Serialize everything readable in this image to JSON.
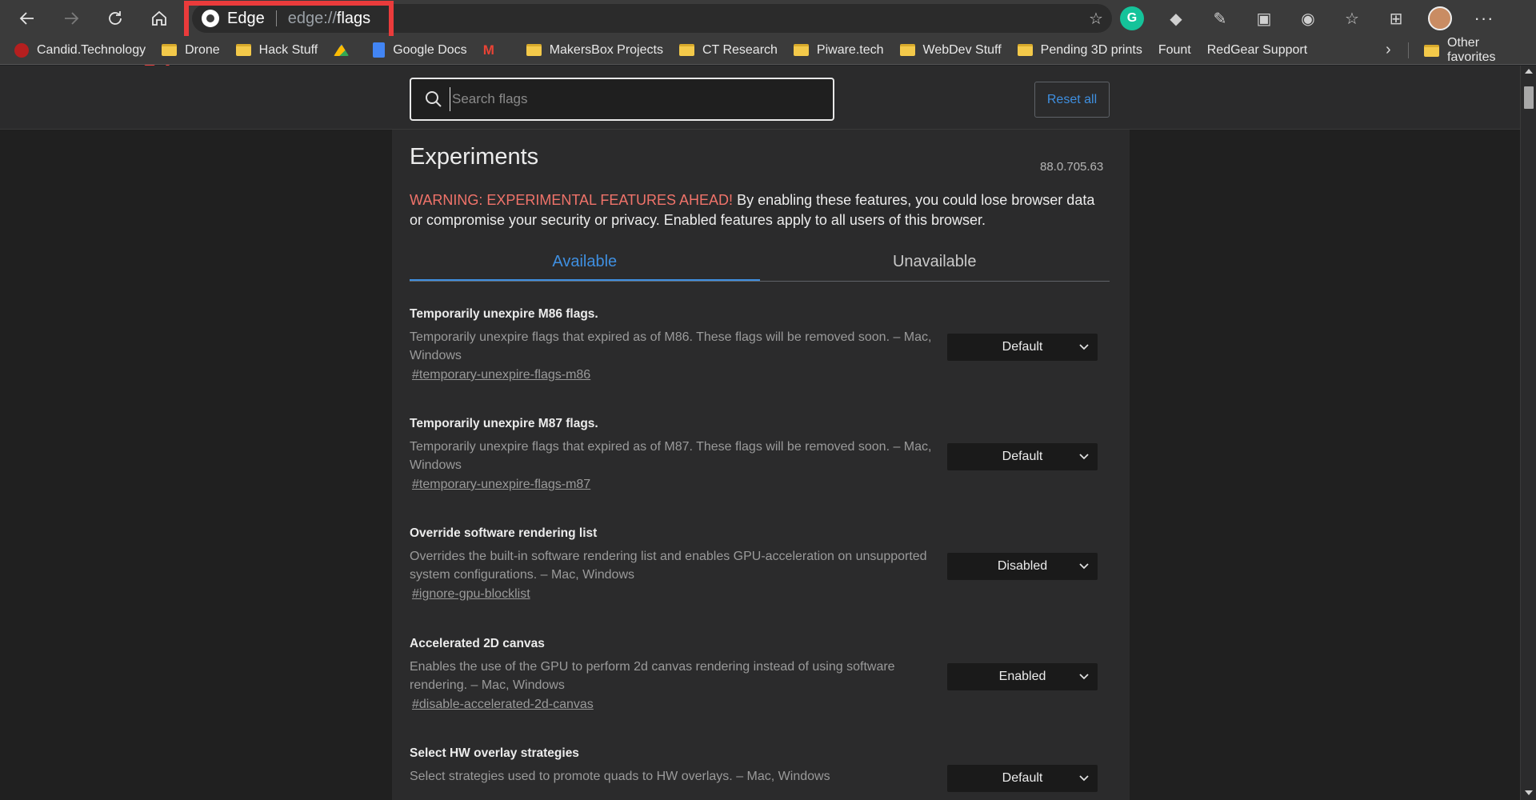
{
  "address_bar": {
    "brand": "Edge",
    "url_prefix": "edge://",
    "url_path": "flags"
  },
  "bookmarks": [
    {
      "label": "Candid.Technology",
      "icon": "site"
    },
    {
      "label": "Drone",
      "icon": "folder"
    },
    {
      "label": "Hack Stuff",
      "icon": "folder"
    },
    {
      "label": "",
      "icon": "drive"
    },
    {
      "label": "Google Docs",
      "icon": "docs"
    },
    {
      "label": "",
      "icon": "gmail"
    },
    {
      "label": "MakersBox Projects",
      "icon": "folder"
    },
    {
      "label": "CT Research",
      "icon": "folder"
    },
    {
      "label": "Piware.tech",
      "icon": "folder"
    },
    {
      "label": "WebDev Stuff",
      "icon": "folder"
    },
    {
      "label": "Pending 3D prints",
      "icon": "folder"
    },
    {
      "label": "Fount",
      "icon": "page"
    },
    {
      "label": "RedGear Support",
      "icon": "page"
    }
  ],
  "other_favorites": "Other favorites",
  "search": {
    "placeholder": "Search flags"
  },
  "reset_all": "Reset all",
  "experiments": {
    "title": "Experiments",
    "version": "88.0.705.63",
    "warning_prefix": "WARNING: EXPERIMENTAL FEATURES AHEAD!",
    "warning_text": " By enabling these features, you could lose browser data or compromise your security or privacy. Enabled features apply to all users of this browser."
  },
  "tabs": {
    "available": "Available",
    "unavailable": "Unavailable"
  },
  "flags": [
    {
      "name": "Temporarily unexpire M86 flags.",
      "desc": "Temporarily unexpire flags that expired as of M86. These flags will be removed soon. – Mac, Windows",
      "link": "#temporary-unexpire-flags-m86",
      "value": "Default"
    },
    {
      "name": "Temporarily unexpire M87 flags.",
      "desc": "Temporarily unexpire flags that expired as of M87. These flags will be removed soon. – Mac, Windows",
      "link": "#temporary-unexpire-flags-m87",
      "value": "Default"
    },
    {
      "name": "Override software rendering list",
      "desc": "Overrides the built-in software rendering list and enables GPU-acceleration on unsupported system configurations. – Mac, Windows",
      "link": "#ignore-gpu-blocklist",
      "value": "Disabled"
    },
    {
      "name": "Accelerated 2D canvas",
      "desc": "Enables the use of the GPU to perform 2d canvas rendering instead of using software rendering. – Mac, Windows",
      "link": "#disable-accelerated-2d-canvas",
      "value": "Enabled"
    },
    {
      "name": "Select HW overlay strategies",
      "desc": "Select strategies used to promote quads to HW overlays. – Mac, Windows",
      "link": "",
      "value": "Default"
    }
  ],
  "colors": {
    "accent": "#3f8fe0",
    "warning": "#f0736a",
    "highlight": "#ea3b3b"
  }
}
